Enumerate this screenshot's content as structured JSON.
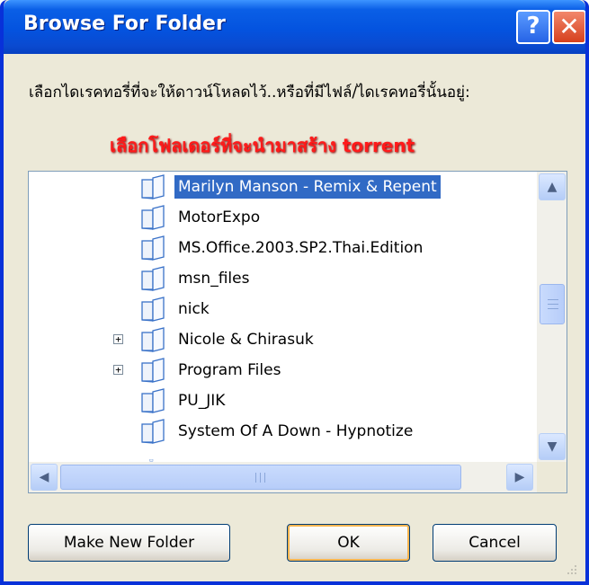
{
  "window": {
    "title": "Browse For Folder",
    "instruction": "เลือกไดเรคทอรี่ที่จะให้ดาวน์โหลดไว้..หรือที่มีไฟล์/ไดเรคทอรี่นั้นอยู่:",
    "overlay_note": "เลือกโฟลเดอร์ที่จะนำมาสร้าง torrent"
  },
  "tree": {
    "items": [
      {
        "label": "Marilyn Manson - Remix & Repent",
        "expandable": false,
        "selected": true
      },
      {
        "label": "MotorExpo",
        "expandable": false,
        "selected": false
      },
      {
        "label": "MS.Office.2003.SP2.Thai.Edition",
        "expandable": false,
        "selected": false
      },
      {
        "label": "msn_files",
        "expandable": false,
        "selected": false
      },
      {
        "label": "nick",
        "expandable": false,
        "selected": false
      },
      {
        "label": "Nicole & Chirasuk",
        "expandable": true,
        "selected": false
      },
      {
        "label": "Program Files",
        "expandable": true,
        "selected": false
      },
      {
        "label": "PU_JIK",
        "expandable": false,
        "selected": false
      },
      {
        "label": "System Of A Down - Hypnotize",
        "expandable": false,
        "selected": false
      }
    ],
    "expander_glyph": "+"
  },
  "buttons": {
    "make_new_folder": "Make New Folder",
    "ok": "OK",
    "cancel": "Cancel"
  },
  "titlebar_buttons": {
    "help": "?",
    "close": "✕"
  },
  "icons": [
    "help-icon",
    "close-icon",
    "folder-icon",
    "expand-plus-icon",
    "scroll-up-arrow-icon",
    "scroll-down-arrow-icon",
    "scroll-left-arrow-icon",
    "scroll-right-arrow-icon",
    "resize-grip-icon"
  ],
  "colors": {
    "titlebar": "#0453df",
    "selection": "#316ac5",
    "overlay_text": "#ff1a1a",
    "dialog_face": "#ece9d8"
  }
}
